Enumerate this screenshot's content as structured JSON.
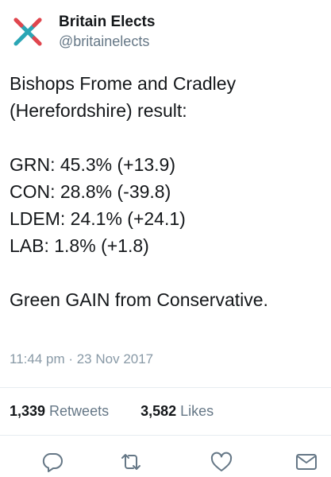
{
  "account": {
    "display_name": "Britain Elects",
    "handle": "@britainelects",
    "avatar_icon": "britain-elects-x-logo-icon"
  },
  "tweet": {
    "lines": [
      "Bishops Frome and Cradley",
      "(Herefordshire) result:",
      "",
      "GRN: 45.3% (+13.9)",
      "CON: 28.8% (-39.8)",
      "LDEM: 24.1% (+24.1)",
      "LAB: 1.8% (+1.8)",
      "",
      "Green GAIN from Conservative."
    ],
    "timestamp": "11:44 pm · 23 Nov 2017"
  },
  "stats": {
    "retweets_count": "1,339",
    "retweets_label": "Retweets",
    "likes_count": "3,582",
    "likes_label": "Likes"
  },
  "actions": {
    "reply_icon": "reply-icon",
    "retweet_icon": "retweet-icon",
    "like_icon": "heart-icon",
    "share_icon": "envelope-icon"
  },
  "colors": {
    "logo_red": "#e0464e",
    "logo_teal": "#2aa6b5",
    "text_primary": "#14171a",
    "text_secondary": "#657786",
    "icon_gray": "#657786",
    "divider": "#e6ecf0"
  }
}
